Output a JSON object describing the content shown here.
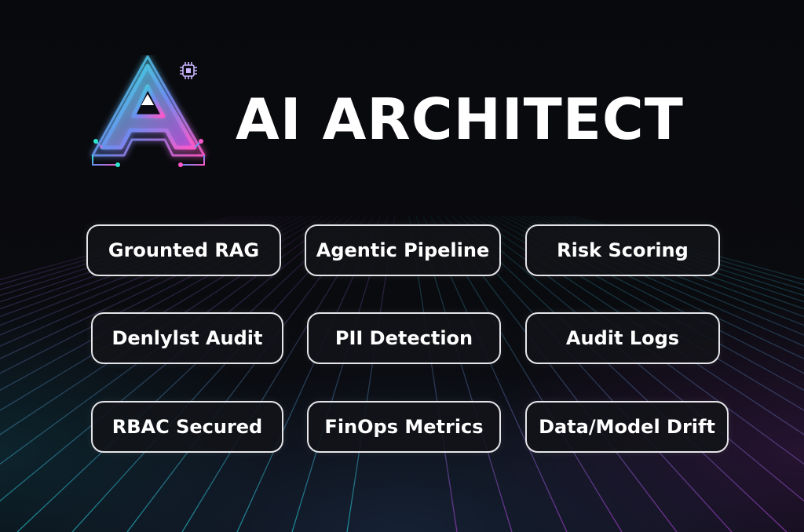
{
  "title": "AI ARCHITECT",
  "logo": {
    "icon": "letter-a-circuit-logo",
    "chip_icon": "cpu-chip-icon",
    "colors": [
      "#2ee6d0",
      "#b05cf0",
      "#ff57c8"
    ]
  },
  "chips": [
    "Grounted RAG",
    "Agentic Pipeline",
    "Risk Scoring",
    "Denlylst Audit",
    "PII Detection",
    "Audit Logs",
    "RBAC Secured",
    "FinOps Metrics",
    "Data/Model Drift"
  ],
  "grid_colors": {
    "left": "#1fb6c0",
    "right": "#9a3bc0"
  }
}
